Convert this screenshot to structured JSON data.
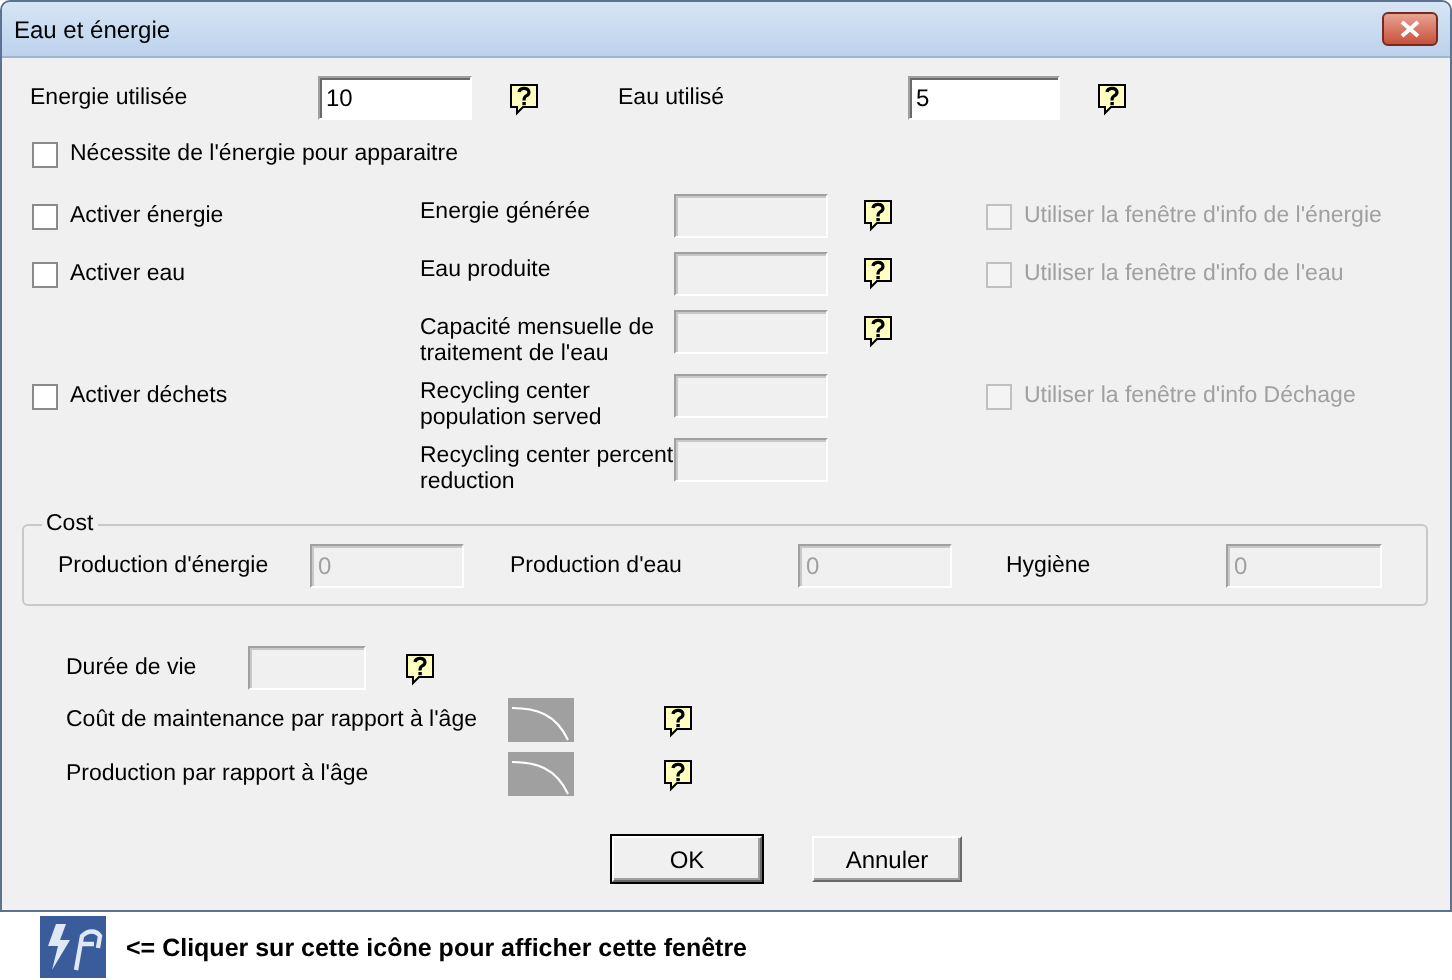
{
  "window": {
    "title": "Eau et énergie"
  },
  "top_fields": [
    {
      "label": "Energie utilisée",
      "value": "10",
      "disabled": false,
      "help": true
    },
    {
      "label": "Eau utilisé",
      "value": "5",
      "disabled": false,
      "help": true
    }
  ],
  "appear_checkbox": {
    "label": "Nécessite de l'énergie pour apparaitre",
    "checked": false,
    "disabled": false
  },
  "rows": [
    {
      "toggle": {
        "label": "Activer énergie",
        "checked": false,
        "disabled": false
      },
      "label": "Energie générée",
      "field": {
        "disabled": true
      },
      "help": true,
      "info": {
        "label": "Utiliser la fenêtre d'info de l'énergie",
        "checked": false,
        "disabled": true
      }
    },
    {
      "toggle": {
        "label": "Activer eau",
        "checked": false,
        "disabled": false
      },
      "label": "Eau produite",
      "field": {
        "disabled": true
      },
      "help": true,
      "info": {
        "label": "Utiliser la fenêtre d'info de l'eau",
        "checked": false,
        "disabled": true
      }
    },
    {
      "label": "Capacité mensuelle de traitement de l'eau",
      "field": {
        "disabled": true
      },
      "help": true
    },
    {
      "toggle": {
        "label": "Activer déchets",
        "checked": false,
        "disabled": false
      },
      "label": "Recycling center population served",
      "field": {
        "disabled": true
      },
      "help": false,
      "info": {
        "label": "Utiliser la fenêtre d'info Déchage",
        "checked": false,
        "disabled": true
      }
    },
    {
      "label": "Recycling center percent reduction",
      "field": {
        "disabled": true
      },
      "help": false
    }
  ],
  "cost": {
    "title": "Cost",
    "fields": [
      {
        "label": "Production d'énergie",
        "value": "0",
        "disabled": true
      },
      {
        "label": "Production d'eau",
        "value": "0",
        "disabled": true
      },
      {
        "label": "Hygiène",
        "value": "0",
        "disabled": true
      }
    ]
  },
  "lifetime": {
    "label": "Durée de vie",
    "disabled": true,
    "help": true
  },
  "curves": [
    {
      "label": "Coût de maintenance par rapport à l'âge",
      "help": true
    },
    {
      "label": "Production par rapport à l'âge",
      "help": true
    }
  ],
  "buttons": [
    {
      "label": "OK",
      "default": true
    },
    {
      "label": "Annuler",
      "default": false
    }
  ],
  "footer": {
    "text": "<= Cliquer sur cette icône pour afficher cette fenêtre"
  }
}
